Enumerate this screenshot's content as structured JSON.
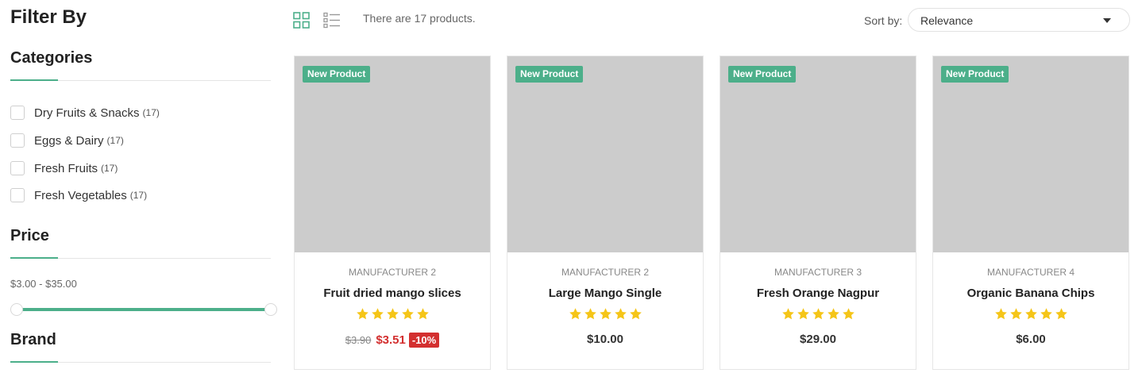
{
  "sidebar": {
    "title": "Filter By",
    "categories": {
      "title": "Categories",
      "items": [
        {
          "label": "Dry Fruits & Snacks",
          "count": "(17)"
        },
        {
          "label": "Eggs & Dairy",
          "count": "(17)"
        },
        {
          "label": "Fresh Fruits",
          "count": "(17)"
        },
        {
          "label": "Fresh Vegetables",
          "count": "(17)"
        }
      ]
    },
    "price": {
      "title": "Price",
      "range_text": "$3.00 - $35.00",
      "slider_min_fraction": 0,
      "slider_max_fraction": 1
    },
    "brand": {
      "title": "Brand"
    }
  },
  "toolbar": {
    "grid_icon": "grid-view-icon",
    "list_icon": "list-view-icon",
    "product_count": "There are 17 products.",
    "sort_label": "Sort by:",
    "sort_value": "Relevance"
  },
  "colors": {
    "accent": "#4caf8a",
    "sale": "#d32f2f",
    "star": "#f5c518",
    "placeholder": "#cccccc"
  },
  "products": [
    {
      "badge": "New Product",
      "manufacturer": "MANUFACTURER 2",
      "name": "Fruit dried mango slices",
      "rating": 5,
      "old_price": "$3.90",
      "price": "$3.51",
      "discount": "-10%"
    },
    {
      "badge": "New Product",
      "manufacturer": "MANUFACTURER 2",
      "name": "Large Mango Single",
      "rating": 5,
      "price": "$10.00"
    },
    {
      "badge": "New Product",
      "manufacturer": "MANUFACTURER 3",
      "name": "Fresh Orange Nagpur",
      "rating": 5,
      "price": "$29.00"
    },
    {
      "badge": "New Product",
      "manufacturer": "MANUFACTURER 4",
      "name": "Organic Banana Chips",
      "rating": 5,
      "price": "$6.00"
    }
  ]
}
